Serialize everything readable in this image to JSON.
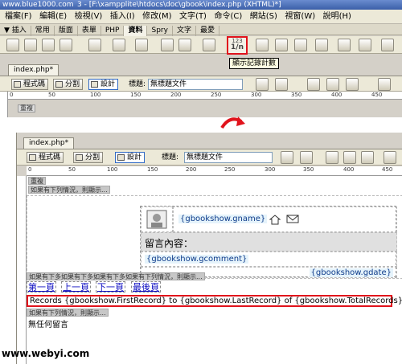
{
  "window_top": {
    "watermark": "www.blue1000.com",
    "title": "3 - [F:\\xampplite\\htdocs\\doc\\gbook\\index.php (XHTML)*]",
    "menu": [
      "檔案(F)",
      "編輯(E)",
      "檢視(V)",
      "插入(I)",
      "修改(M)",
      "文字(T)",
      "命令(C)",
      "網站(S)",
      "視窗(W)",
      "說明(H)"
    ],
    "insert_tabs": [
      "▼ 插入",
      "常用",
      "版面",
      "表單",
      "PHP",
      "資料",
      "Spry",
      "文字",
      "最愛"
    ],
    "record_count_icon_text": "123",
    "tooltip": "顯示記錄計數",
    "doc_tab": "index.php*",
    "views": [
      "程式碼",
      "分割",
      "設計"
    ],
    "title_label": "標題:",
    "title_value": "無標題文件",
    "ruler_marks": [
      "0",
      "50",
      "100",
      "150",
      "200",
      "250",
      "300",
      "350",
      "400",
      "450"
    ],
    "body_tag": "重複"
  },
  "window_bottom": {
    "doc_tab": "index.php*",
    "views": [
      "程式碼",
      "分割",
      "設計"
    ],
    "title_label": "標題:",
    "title_value": "無標題文件",
    "ruler_marks": [
      "0",
      "50",
      "100",
      "150",
      "200",
      "250",
      "300",
      "350",
      "400",
      "450"
    ],
    "repeat_tag": "重複",
    "if_tag": "如果有下列情況，則顯示...",
    "gname": "{gbookshow.gname}",
    "message_label": "留言內容：",
    "gcomment": "{gbookshow.gcomment}",
    "gdate": "{gbookshow.gdate}",
    "nav_tags": "如果有下多如果有下多如果有下多如果有下列情況，則顯示...",
    "nav_links": [
      "第一頁",
      "上一頁",
      "下一頁",
      "最後頁"
    ],
    "records_line": "Records {gbookshow.FirstRecord} to {gbookshow.LastRecord} of {gbookshow.TotalRecords}",
    "if_tag2": "如果有下列情況，則顯示...",
    "footer_text": "無任何留言"
  },
  "bottom_watermark": "www.webyi.com",
  "colors": {
    "highlight": "#e1131c",
    "link": "#0d0dc2",
    "binding_bg": "#e5f3fb"
  }
}
